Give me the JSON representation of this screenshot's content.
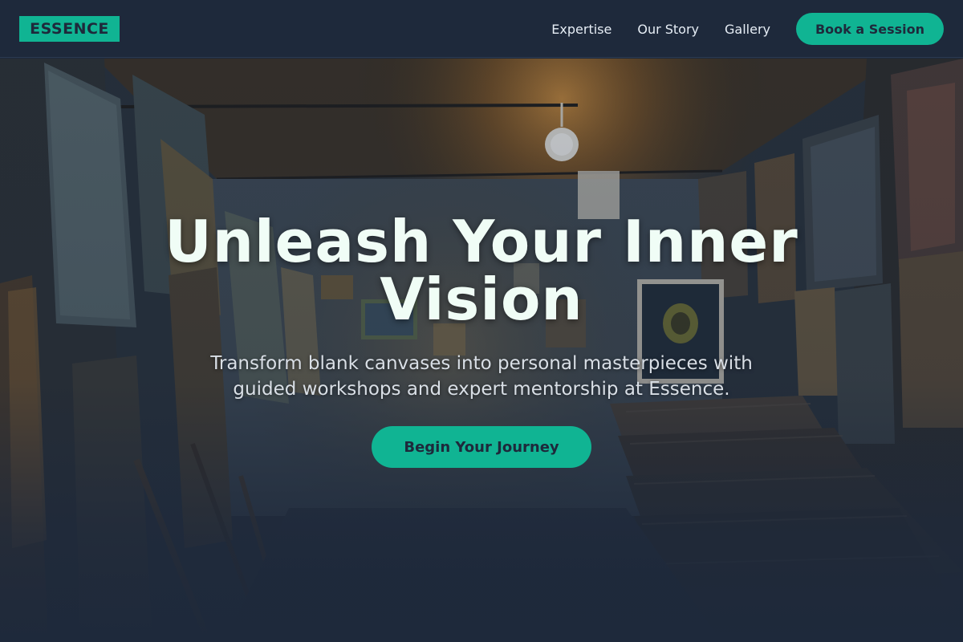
{
  "brand": {
    "logo_text": "ESSENCE",
    "accent_color": "#10b493",
    "background_color": "#1e293b"
  },
  "nav": {
    "links": [
      {
        "label": "Expertise"
      },
      {
        "label": "Our Story"
      },
      {
        "label": "Gallery"
      }
    ],
    "cta_label": "Book a Session"
  },
  "hero": {
    "title": "Unleash Your Inner Vision",
    "subtitle": "Transform blank canvases into personal masterpieces with guided workshops and expert mentorship at Essence.",
    "cta_label": "Begin Your Journey",
    "background_image": "art-gallery-storage-room"
  }
}
